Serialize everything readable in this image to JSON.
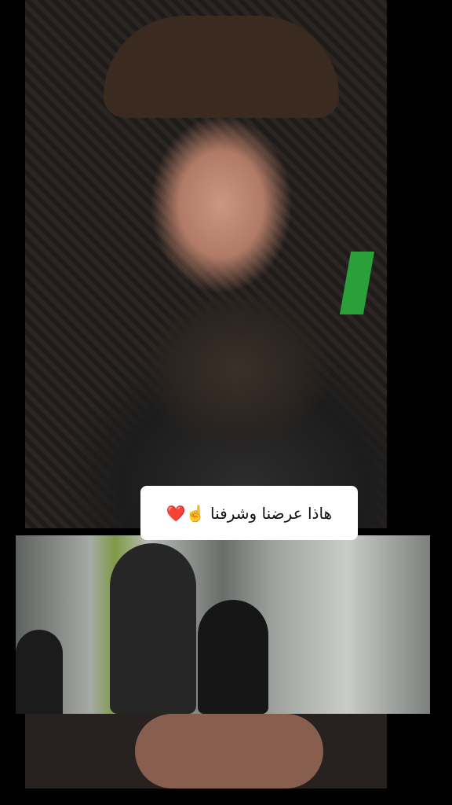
{
  "caption": {
    "text": "هاذا عرضنا وشرفنا ☝️❤️"
  },
  "colors": {
    "background": "#000000",
    "caption_bg": "#ffffff",
    "caption_text": "#111111"
  }
}
